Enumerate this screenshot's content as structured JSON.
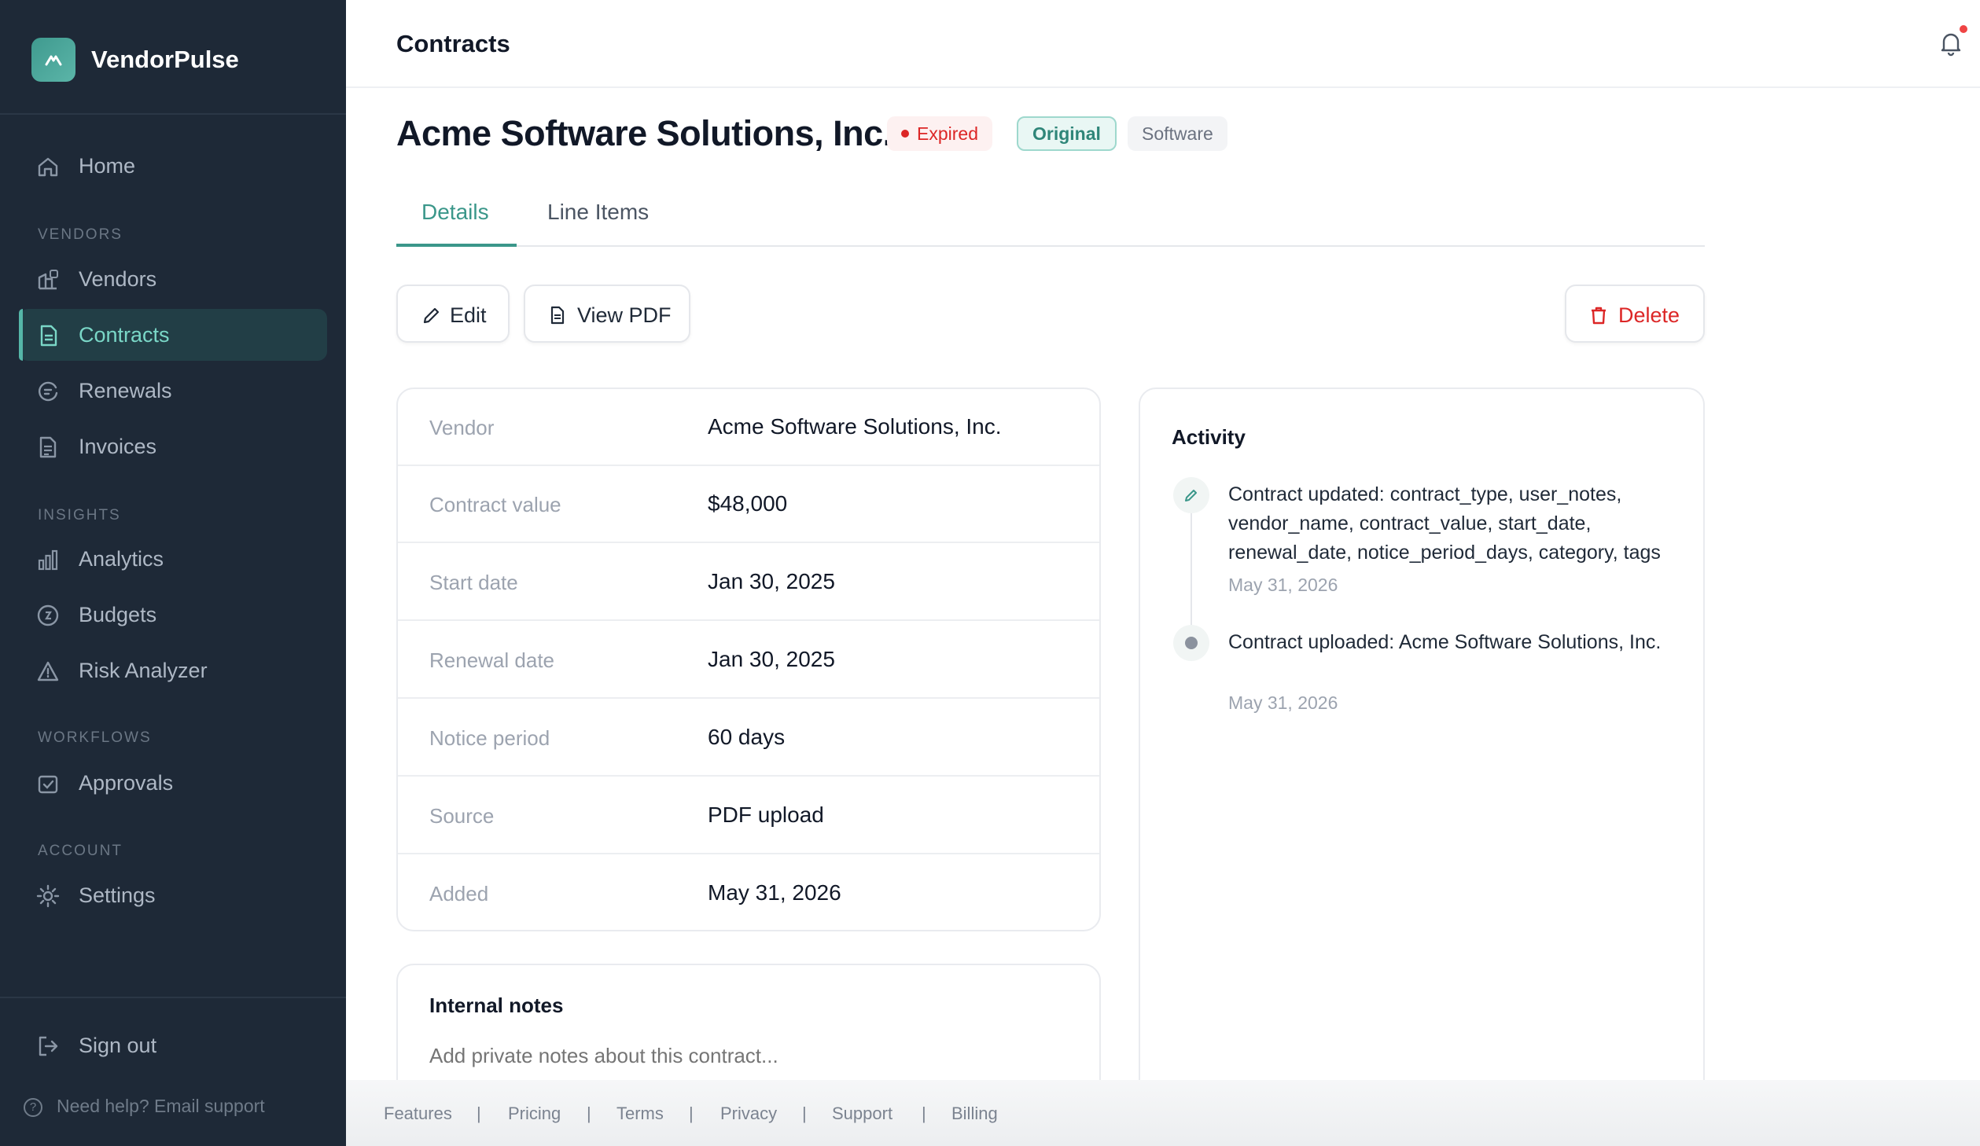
{
  "app": {
    "name": "VendorPulse",
    "logo_icon": "mountain-icon"
  },
  "sidebar": {
    "home": "Home",
    "sections": [
      "VENDORS",
      "INSIGHTS",
      "WORKFLOWS",
      "ACCOUNT"
    ],
    "items": [
      {
        "label": "Vendors",
        "icon": "vendor-building-icon"
      },
      {
        "label": "Contracts",
        "icon": "document-icon",
        "active": true
      },
      {
        "label": "Renewals",
        "icon": "renewal-icon"
      },
      {
        "label": "Invoices",
        "icon": "invoice-icon"
      },
      {
        "label": "Analytics",
        "icon": "bar-chart-icon"
      },
      {
        "label": "Budgets",
        "icon": "budget-icon"
      },
      {
        "label": "Risk Analyzer",
        "icon": "warning-icon"
      },
      {
        "label": "Approvals",
        "icon": "approval-icon"
      },
      {
        "label": "Settings",
        "icon": "gear-icon"
      }
    ],
    "sign_out": "Sign out",
    "help": "Need help? Email support"
  },
  "header": {
    "title": "Contracts",
    "notifications": "bell-icon"
  },
  "contract": {
    "title": "Acme Software Solutions, Inc.",
    "badges": {
      "status": "Expired",
      "type": "Original",
      "category": "Software"
    },
    "status_color": "#dc2626",
    "accent_color": "#3b978a"
  },
  "tabs": [
    "Details",
    "Line Items"
  ],
  "actions": {
    "edit": "Edit",
    "view_pdf": "View PDF",
    "delete": "Delete"
  },
  "details": [
    {
      "key": "Vendor",
      "value": "Acme Software Solutions, Inc."
    },
    {
      "key": "Contract value",
      "value": "$48,000"
    },
    {
      "key": "Start date",
      "value": "Jan 30, 2025"
    },
    {
      "key": "Renewal date",
      "value": "Jan 30, 2025"
    },
    {
      "key": "Notice period",
      "value": "60 days"
    },
    {
      "key": "Source",
      "value": "PDF upload"
    },
    {
      "key": "Added",
      "value": "May 31, 2026"
    }
  ],
  "notes": {
    "title": "Internal notes",
    "placeholder": "Add private notes about this contract..."
  },
  "activity": {
    "title": "Activity",
    "events": [
      {
        "text": "Contract updated: contract_type, user_notes, vendor_name, contract_value, start_date, renewal_date, notice_period_days, category, tags",
        "date": "May 31, 2026"
      },
      {
        "text": "Contract uploaded: Acme Software Solutions, Inc.",
        "date": "May 31, 2026"
      }
    ]
  },
  "footer": [
    "Features",
    "Pricing",
    "Terms",
    "Privacy",
    "Support",
    "Billing"
  ]
}
